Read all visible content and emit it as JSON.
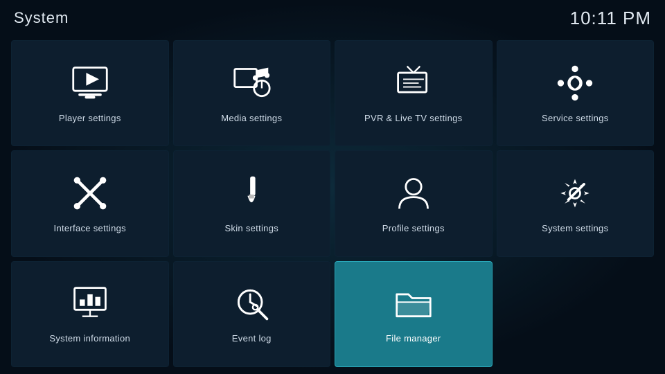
{
  "header": {
    "title": "System",
    "clock": "10:11 PM"
  },
  "tiles": [
    {
      "id": "player-settings",
      "label": "Player settings",
      "icon": "player",
      "active": false
    },
    {
      "id": "media-settings",
      "label": "Media settings",
      "icon": "media",
      "active": false
    },
    {
      "id": "pvr-settings",
      "label": "PVR & Live TV settings",
      "icon": "pvr",
      "active": false
    },
    {
      "id": "service-settings",
      "label": "Service settings",
      "icon": "service",
      "active": false
    },
    {
      "id": "interface-settings",
      "label": "Interface settings",
      "icon": "interface",
      "active": false
    },
    {
      "id": "skin-settings",
      "label": "Skin settings",
      "icon": "skin",
      "active": false
    },
    {
      "id": "profile-settings",
      "label": "Profile settings",
      "icon": "profile",
      "active": false
    },
    {
      "id": "system-settings",
      "label": "System settings",
      "icon": "system",
      "active": false
    },
    {
      "id": "system-information",
      "label": "System information",
      "icon": "sysinfo",
      "active": false
    },
    {
      "id": "event-log",
      "label": "Event log",
      "icon": "eventlog",
      "active": false
    },
    {
      "id": "file-manager",
      "label": "File manager",
      "icon": "filemanager",
      "active": true
    }
  ]
}
